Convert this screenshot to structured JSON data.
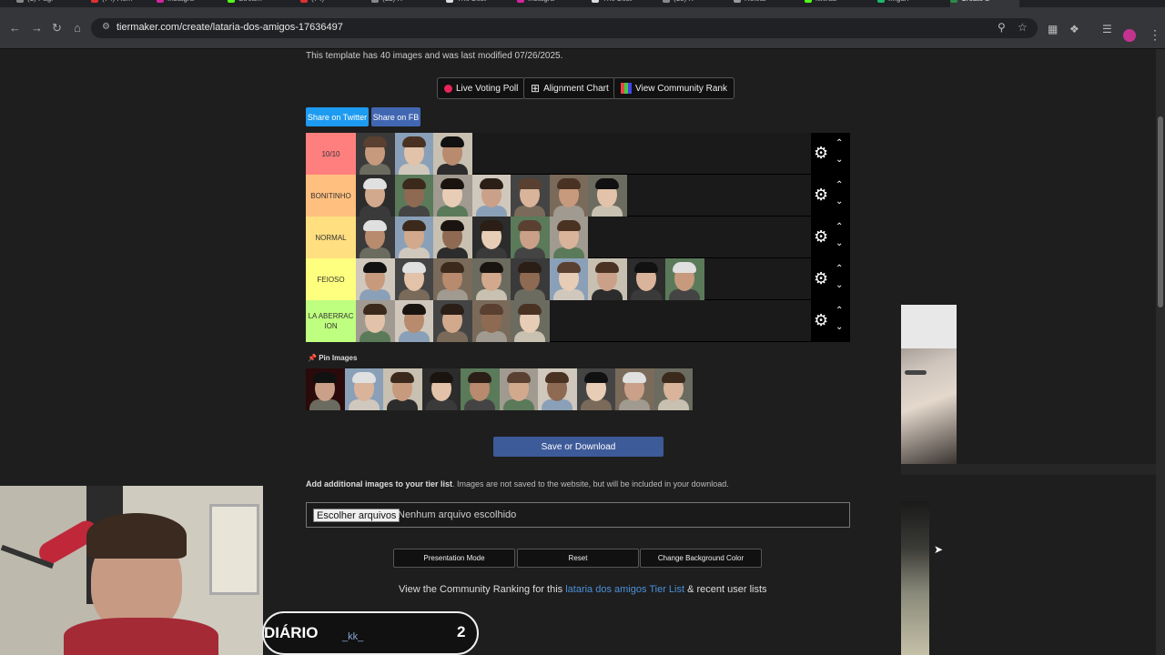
{
  "browser": {
    "tabs": [
      {
        "label": "(1) Pági",
        "color": "#888"
      },
      {
        "label": "(74) Hom",
        "color": "#e03030"
      },
      {
        "label": "Instagra",
        "color": "#d6249f"
      },
      {
        "label": "Stream",
        "color": "#53fc18"
      },
      {
        "label": "(74)",
        "color": "#e03030"
      },
      {
        "label": "(12) X",
        "color": "#888"
      },
      {
        "label": "The Best",
        "color": "#ddd"
      },
      {
        "label": "Instagra",
        "color": "#d6249f"
      },
      {
        "label": "The Best",
        "color": "#ddd"
      },
      {
        "label": "(18) X",
        "color": "#888"
      },
      {
        "label": "Roleta",
        "color": "#999"
      },
      {
        "label": "kikirau",
        "color": "#53fc18"
      },
      {
        "label": "Imgur:",
        "color": "#1bb76e"
      },
      {
        "label": "Create a",
        "color": "#2a8a4a"
      }
    ],
    "url": "tiermaker.com/create/lataria-dos-amigos-17636497"
  },
  "page": {
    "info": "This template has 40 images and was last modified 07/26/2025.",
    "buttons": {
      "live_voting": "Live Voting Poll",
      "alignment": "Alignment Chart",
      "community_rank": "View Community Rank",
      "share_twitter": "Share on Twitter",
      "share_fb": "Share on FB"
    },
    "tiers": [
      {
        "label": "10/10",
        "color": "#ff7f7f",
        "count": 3
      },
      {
        "label": "BONITINHO",
        "color": "#ffbf7f",
        "count": 7
      },
      {
        "label": "NORMAL",
        "color": "#ffdf7f",
        "count": 6
      },
      {
        "label": "FEIOSO",
        "color": "#ffff7f",
        "count": 9
      },
      {
        "label": "LA ABERRACION",
        "color": "#bfff7f",
        "count": 5
      }
    ],
    "pin_images": "Pin Images",
    "pin_count": 10,
    "save_button": "Save or Download",
    "add_images_bold": "Add additional images to your tier list",
    "add_images_rest": ". Images are not saved to the website, but will be included in your download.",
    "file_button": "Escolher arquivos",
    "file_status": "Nenhum arquivo escolhido",
    "presentation_mode": "Presentation Mode",
    "reset": "Reset",
    "change_bg": "Change Background Color",
    "community_prefix": "View the Community Ranking for this ",
    "community_link": "lataria dos amigos Tier List",
    "community_suffix": " & recent user lists"
  },
  "stream_overlay": {
    "title": "DIÁRIO",
    "subtitle": "_kk_",
    "number": "2"
  }
}
